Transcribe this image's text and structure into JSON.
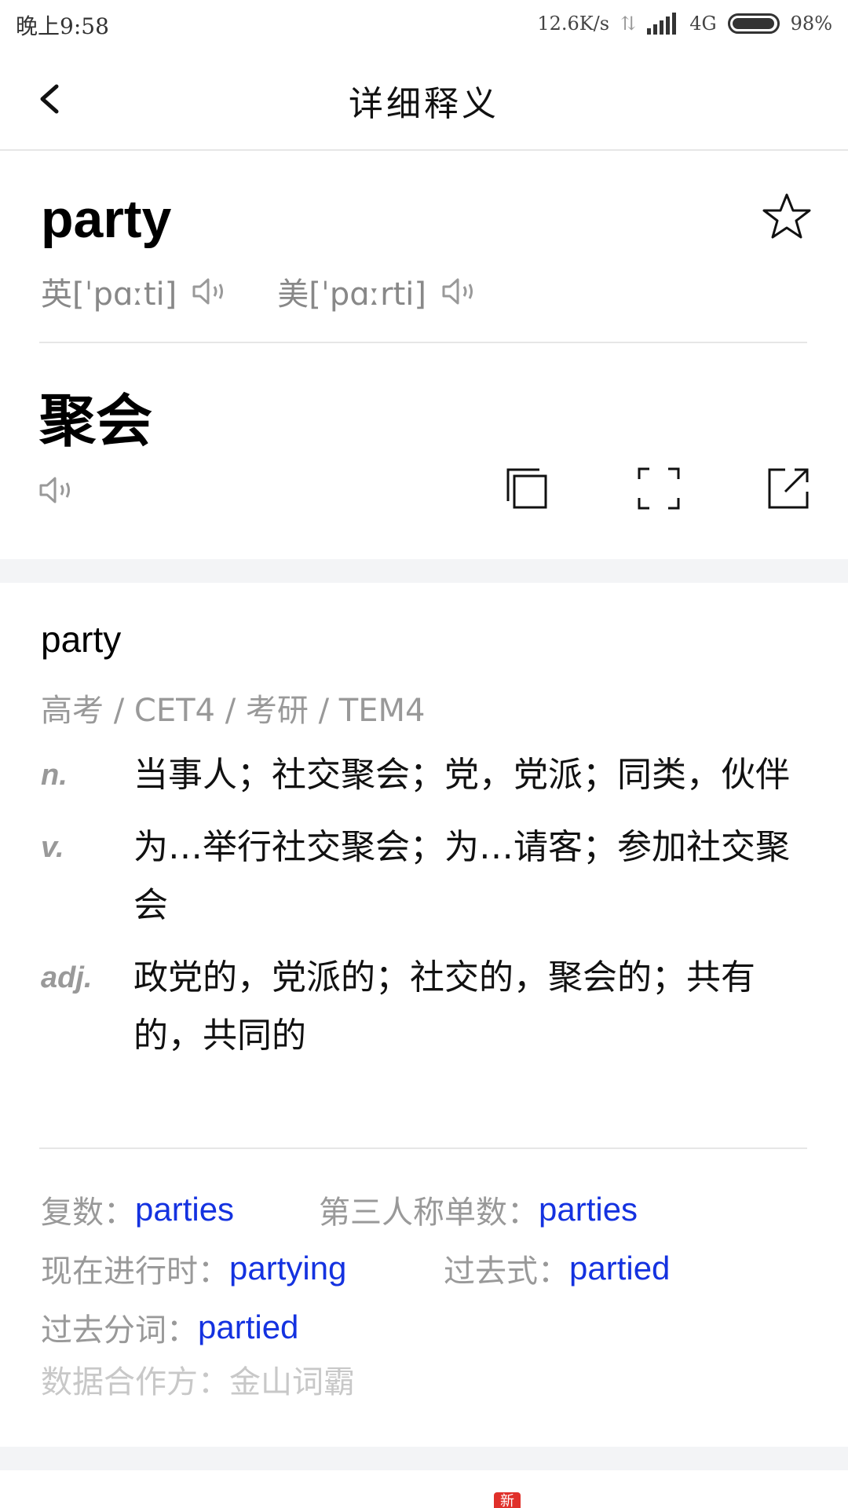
{
  "status_bar": {
    "time": "晚上9:58",
    "net_speed": "12.6K/s",
    "network": "4G",
    "battery": "98%",
    "battery_level": 0.98
  },
  "header": {
    "title": "详细释义"
  },
  "word_card": {
    "word": "party",
    "phonetic_uk": "英[ˈpɑːti]",
    "phonetic_us": "美[ˈpɑːrti]",
    "translation": "聚会"
  },
  "definition": {
    "word": "party",
    "tags": "高考 / CET4 / 考研 / TEM4",
    "meanings": [
      {
        "pos": "n.",
        "text": "当事人；社交聚会；党，党派；同类，伙伴"
      },
      {
        "pos": "v.",
        "text": "为…举行社交聚会；为…请客；参加社交聚会"
      },
      {
        "pos": "adj.",
        "text": "政党的，党派的；社交的，聚会的；共有的，共同的"
      }
    ],
    "forms": {
      "plural_label": "复数：",
      "plural": "parties",
      "third_person_label": "第三人称单数：",
      "third_person": "parties",
      "present_participle_label": "现在进行时：",
      "present_participle": "partying",
      "past_tense_label": "过去式：",
      "past_tense": "partied",
      "past_participle_label": "过去分词：",
      "past_participle": "partied"
    },
    "source": "数据合作方：金山词霸"
  },
  "bottom": {
    "badge": "新"
  },
  "colors": {
    "link": "#1432e0",
    "muted": "#999999",
    "band": "#f3f4f6",
    "badge": "#e0302a"
  }
}
